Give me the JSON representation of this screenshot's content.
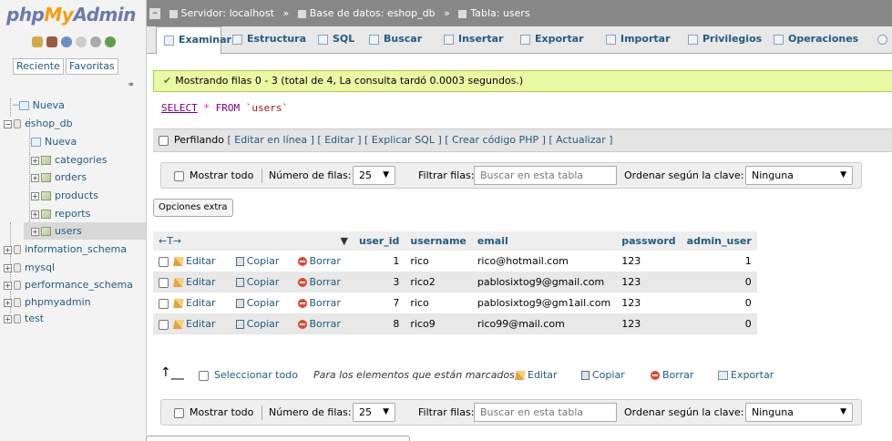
{
  "logo": {
    "php": "php",
    "my": "My",
    "admin": "Admin"
  },
  "nav": {
    "tabs": [
      "Reciente",
      "Favoritas"
    ],
    "link_icon": "chain-link-icon",
    "tree": [
      {
        "label": "Nueva",
        "type": "new"
      },
      {
        "label": "eshop_db",
        "type": "db",
        "expanded": true
      },
      {
        "label": "Nueva",
        "type": "new"
      },
      {
        "label": "categories",
        "type": "table"
      },
      {
        "label": "orders",
        "type": "table"
      },
      {
        "label": "products",
        "type": "table"
      },
      {
        "label": "reports",
        "type": "table"
      },
      {
        "label": "users",
        "type": "table",
        "selected": true
      },
      {
        "label": "information_schema",
        "type": "db"
      },
      {
        "label": "mysql",
        "type": "db"
      },
      {
        "label": "performance_schema",
        "type": "db"
      },
      {
        "label": "phpmyadmin",
        "type": "db"
      },
      {
        "label": "test",
        "type": "db"
      }
    ]
  },
  "breadcrumb": {
    "server": "Servidor: localhost",
    "database": "Base de datos: eshop_db",
    "table": "Tabla: users",
    "separator": "»"
  },
  "tabs": [
    {
      "label": "Examinar",
      "active": true
    },
    {
      "label": "Estructura"
    },
    {
      "label": "SQL"
    },
    {
      "label": "Buscar"
    },
    {
      "label": "Insertar"
    },
    {
      "label": "Exportar"
    },
    {
      "label": "Importar"
    },
    {
      "label": "Privilegios"
    },
    {
      "label": "Operaciones"
    }
  ],
  "message": "Mostrando filas 0 - 3 (total de 4, La consulta tardó 0.0003 segundos.)",
  "sql": {
    "select": "SELECT",
    "star": "*",
    "from": "FROM",
    "table": "`users`"
  },
  "profiling": {
    "label": "Perfilando",
    "links": "[ Editar en línea ] [ Editar ] [ Explicar SQL ] [ Crear código PHP ] [ Actualizar ]"
  },
  "navbar": {
    "show_all": "Mostrar todo",
    "rows_label": "Número de filas:",
    "rows_value": "25",
    "filter_label": "Filtrar filas:",
    "filter_placeholder": "Buscar en esta tabla",
    "sort_label": "Ordenar según la clave:",
    "sort_value": "Ninguna"
  },
  "extra_options": "Opciones extra",
  "table": {
    "columns": [
      "user_id",
      "username",
      "email",
      "password",
      "admin_user"
    ],
    "actions": {
      "edit": "Editar",
      "copy": "Copiar",
      "delete": "Borrar"
    },
    "rows": [
      {
        "user_id": "1",
        "username": "rico",
        "email": "rico@hotmail.com",
        "password": "123",
        "admin_user": "1"
      },
      {
        "user_id": "3",
        "username": "rico2",
        "email": "pablosixtog9@gmail.com",
        "password": "123",
        "admin_user": "0"
      },
      {
        "user_id": "7",
        "username": "rico",
        "email": "pablosixtog9@gm1ail.com",
        "password": "123",
        "admin_user": "0"
      },
      {
        "user_id": "8",
        "username": "rico9",
        "email": "rico99@mail.com",
        "password": "123",
        "admin_user": "0"
      }
    ]
  },
  "bulk": {
    "select_all": "Seleccionar todo",
    "marked": "Para los elementos que están marcados:",
    "edit": "Editar",
    "copy": "Copiar",
    "delete": "Borrar",
    "export": "Exportar"
  }
}
